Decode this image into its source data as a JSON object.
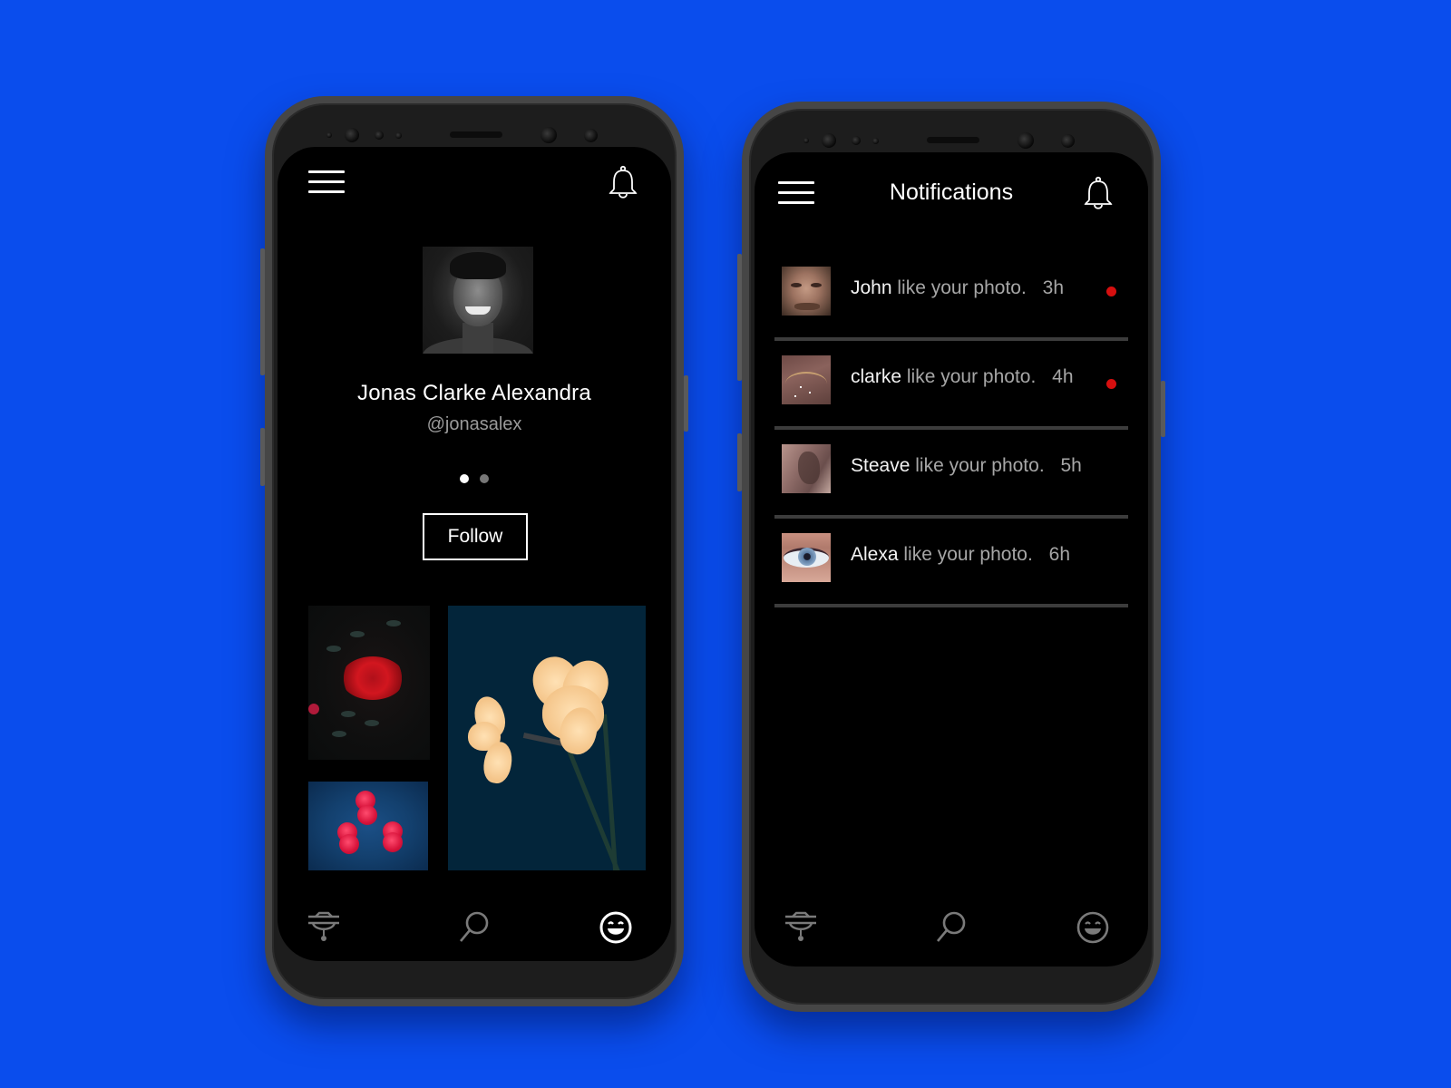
{
  "background_color": "#0a4ded",
  "profile_screen": {
    "menu_icon": "hamburger-menu-icon",
    "bell_icon": "bell-icon",
    "name": "Jonas Clarke Alexandra",
    "handle": "@jonasalex",
    "carousel": {
      "total_pages": 2,
      "active_page": 1
    },
    "follow_label": "Follow",
    "gallery": [
      {
        "subject": "red rose"
      },
      {
        "subject": "daffodils"
      },
      {
        "subject": "pink boutonnieres"
      }
    ],
    "bottom_nav": [
      {
        "icon": "lamp-icon",
        "label": "feed",
        "active": false
      },
      {
        "icon": "search-icon",
        "label": "search",
        "active": false
      },
      {
        "icon": "smiley-icon",
        "label": "profile",
        "active": true
      }
    ]
  },
  "notifications_screen": {
    "title": "Notifications",
    "menu_icon": "hamburger-menu-icon",
    "bell_icon": "bell-icon",
    "items": [
      {
        "user": "John",
        "action": "like your photo.",
        "time": "3h",
        "unread": true
      },
      {
        "user": "clarke",
        "action": "like your photo.",
        "time": "4h",
        "unread": true
      },
      {
        "user": "Steave",
        "action": "like your photo.",
        "time": "5h",
        "unread": false
      },
      {
        "user": "Alexa",
        "action": "like your photo.",
        "time": "6h",
        "unread": false
      }
    ],
    "unread_color": "#d60f0f",
    "bottom_nav": [
      {
        "icon": "lamp-icon",
        "label": "feed",
        "active": false
      },
      {
        "icon": "search-icon",
        "label": "search",
        "active": false
      },
      {
        "icon": "smiley-icon",
        "label": "profile",
        "active": false
      }
    ]
  }
}
